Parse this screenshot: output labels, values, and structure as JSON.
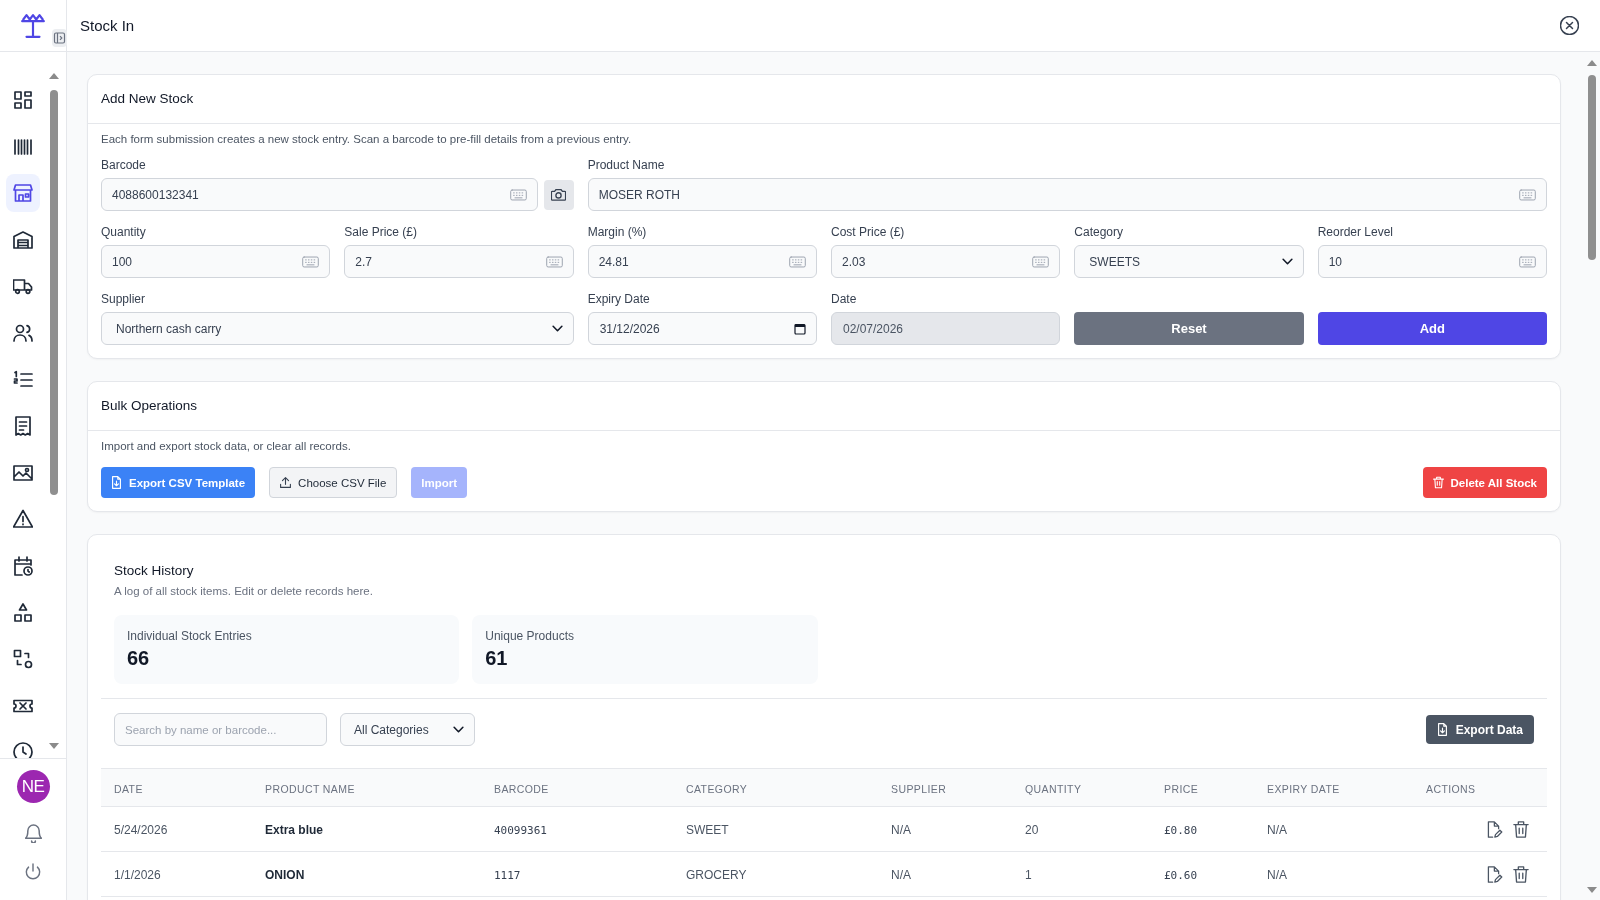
{
  "sidebar": {
    "nav_items": [
      {
        "selected": false
      },
      {
        "selected": false
      },
      {
        "selected": true
      },
      {
        "selected": false
      },
      {
        "selected": false
      },
      {
        "selected": false
      },
      {
        "selected": false
      },
      {
        "selected": false
      },
      {
        "selected": false
      },
      {
        "selected": false
      },
      {
        "selected": false
      },
      {
        "selected": false
      },
      {
        "selected": false
      },
      {
        "selected": false
      },
      {
        "selected": false
      }
    ],
    "user_initials": "NE"
  },
  "header": {
    "title": "Stock In"
  },
  "add_stock": {
    "title": "Add New Stock",
    "description": "Each form submission creates a new stock entry. Scan a barcode to pre-fill details from a previous entry.",
    "fields": [
      {
        "label": "Barcode",
        "value": "4088600132341",
        "kind": "scan"
      },
      {
        "label": "Product Name",
        "value": "MOSER ROTH",
        "kind": "text"
      },
      {
        "label": "Quantity",
        "value": "100",
        "kind": "text"
      },
      {
        "label": "Sale Price (£)",
        "value": "2.7",
        "kind": "text"
      },
      {
        "label": "Margin (%)",
        "value": "24.81",
        "kind": "text"
      },
      {
        "label": "Cost Price (£)",
        "value": "2.03",
        "kind": "text"
      },
      {
        "label": "Category",
        "value": "SWEETS",
        "kind": "select"
      },
      {
        "label": "Reorder Level",
        "value": "10",
        "kind": "text"
      },
      {
        "label": "Supplier",
        "value": "Northern cash carry",
        "kind": "select"
      },
      {
        "label": "Expiry Date",
        "value": "31/12/2026",
        "kind": "date"
      },
      {
        "label": "Date",
        "value": "02/07/2026",
        "kind": "readonly"
      }
    ],
    "buttons": [
      {
        "label": "Reset",
        "kind": "secondary"
      },
      {
        "label": "Add",
        "kind": "primary"
      }
    ]
  },
  "bulk_operations": {
    "title": "Bulk Operations",
    "description": "Import and export stock data, or clear all records.",
    "buttons": [
      {
        "label": "Export CSV Template",
        "kind": "export",
        "disabled": false
      },
      {
        "label": "Choose CSV File",
        "kind": "file",
        "disabled": false
      },
      {
        "label": "Import",
        "kind": "import",
        "disabled": true
      },
      {
        "label": "Delete All Stock",
        "kind": "danger",
        "disabled": false
      }
    ]
  },
  "stock_history": {
    "title": "Stock History",
    "subtitle": "A log of all stock items. Edit or delete records here.",
    "stats": [
      {
        "label": "Individual Stock Entries",
        "value": "66"
      },
      {
        "label": "Unique Products",
        "value": "61"
      }
    ],
    "search": {
      "placeholder": "Search by name or barcode..."
    },
    "category_filter": {
      "value": "All Categories"
    },
    "export_button": {
      "label": "Export Data"
    },
    "table": {
      "columns": [
        "DATE",
        "PRODUCT NAME",
        "BARCODE",
        "CATEGORY",
        "SUPPLIER",
        "QUANTITY",
        "PRICE",
        "EXPIRY DATE",
        "ACTIONS"
      ],
      "rows": [
        {
          "cells": [
            "5/24/2026",
            "Extra blue",
            "40099361",
            "SWEET",
            "N/A",
            "20",
            "£0.80",
            "N/A"
          ]
        },
        {
          "cells": [
            "1/1/2026",
            "ONION",
            "1117",
            "GROCERY",
            "N/A",
            "1",
            "£0.60",
            "N/A"
          ]
        }
      ]
    }
  }
}
